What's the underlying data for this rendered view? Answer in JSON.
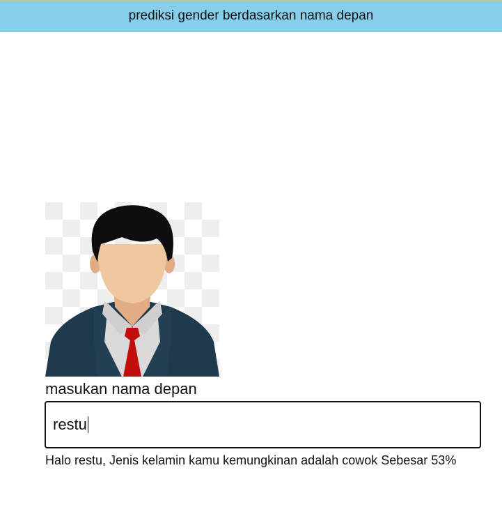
{
  "header": {
    "title": "prediksi gender berdasarkan nama depan"
  },
  "avatar": {
    "icon": "male-businessman-avatar-icon",
    "colors": {
      "hair": "#0e0e10",
      "skin": "#f0c8a0",
      "skin_shadow": "#e2ad84",
      "suit": "#1f3a4d",
      "shirt": "#d9d9d9",
      "tie": "#c20d0d",
      "checker_light": "#f2f2f2",
      "checker_dark": "#ffffff"
    }
  },
  "form": {
    "label": "masukan nama depan",
    "input_value": "restu"
  },
  "result": {
    "text": "Halo restu, Jenis kelamin kamu kemungkinan adalah cowok Sebesar 53%"
  },
  "theme": {
    "header_bg": "#87ceeb"
  }
}
